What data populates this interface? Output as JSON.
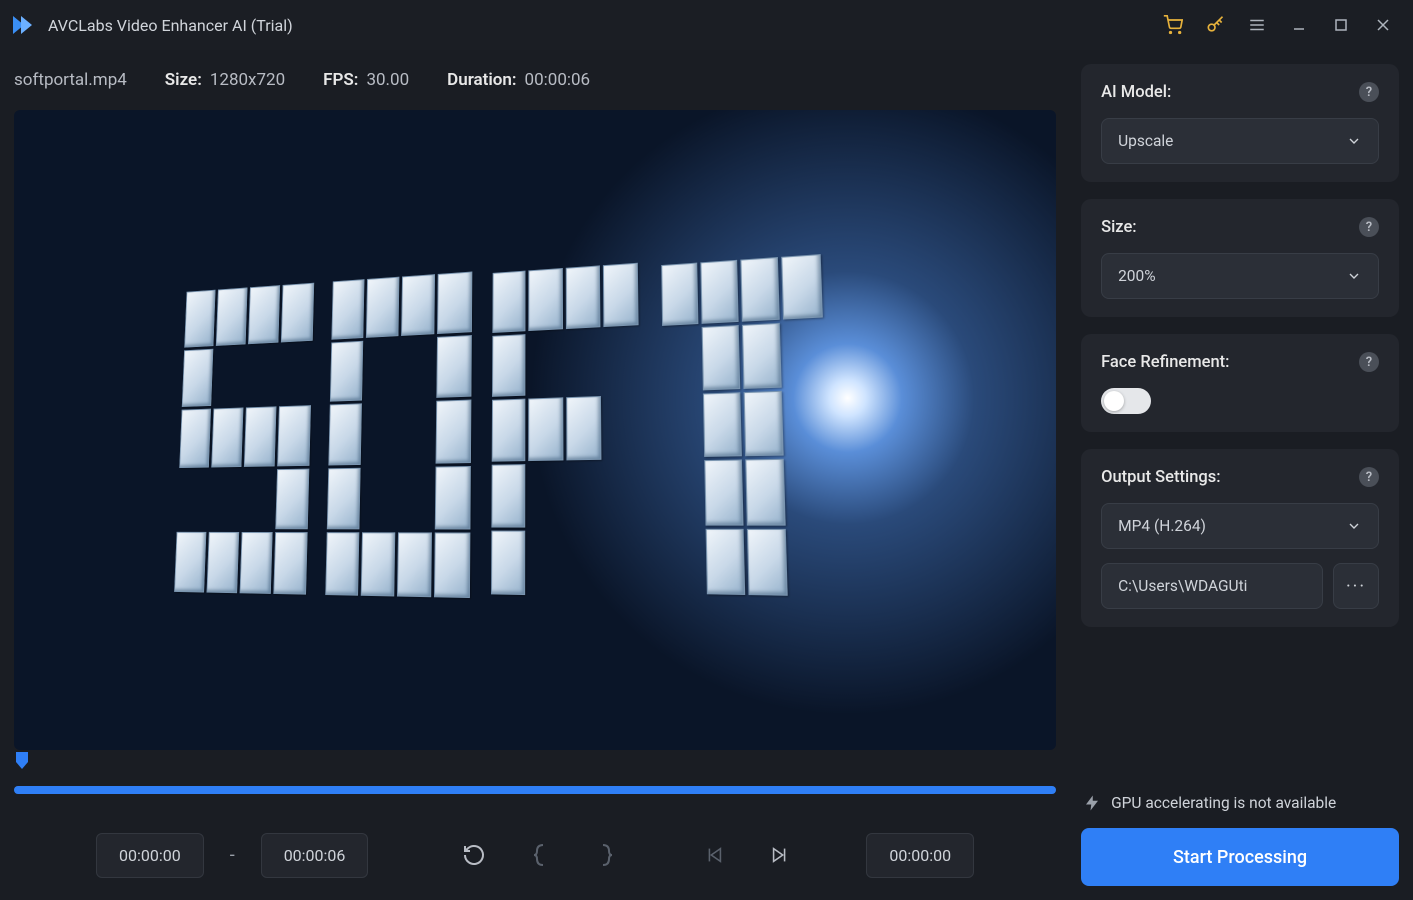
{
  "titlebar": {
    "app_title": "AVCLabs Video Enhancer AI (Trial)"
  },
  "info": {
    "filename": "softportal.mp4",
    "size_label": "Size:",
    "size_value": "1280x720",
    "fps_label": "FPS:",
    "fps_value": "30.00",
    "duration_label": "Duration:",
    "duration_value": "00:00:06"
  },
  "timeline": {
    "start": "00:00:00",
    "end": "00:00:06",
    "current": "00:00:00",
    "dash": "-"
  },
  "panels": {
    "ai_model": {
      "title": "AI Model:",
      "value": "Upscale"
    },
    "size": {
      "title": "Size:",
      "value": "200%"
    },
    "face": {
      "title": "Face Refinement:"
    },
    "output": {
      "title": "Output Settings:",
      "format": "MP4 (H.264)",
      "path": "C:\\Users\\WDAGUti"
    }
  },
  "footer": {
    "gpu_text": "GPU accelerating is not available",
    "start_label": "Start Processing"
  },
  "help": "?",
  "more": "···"
}
